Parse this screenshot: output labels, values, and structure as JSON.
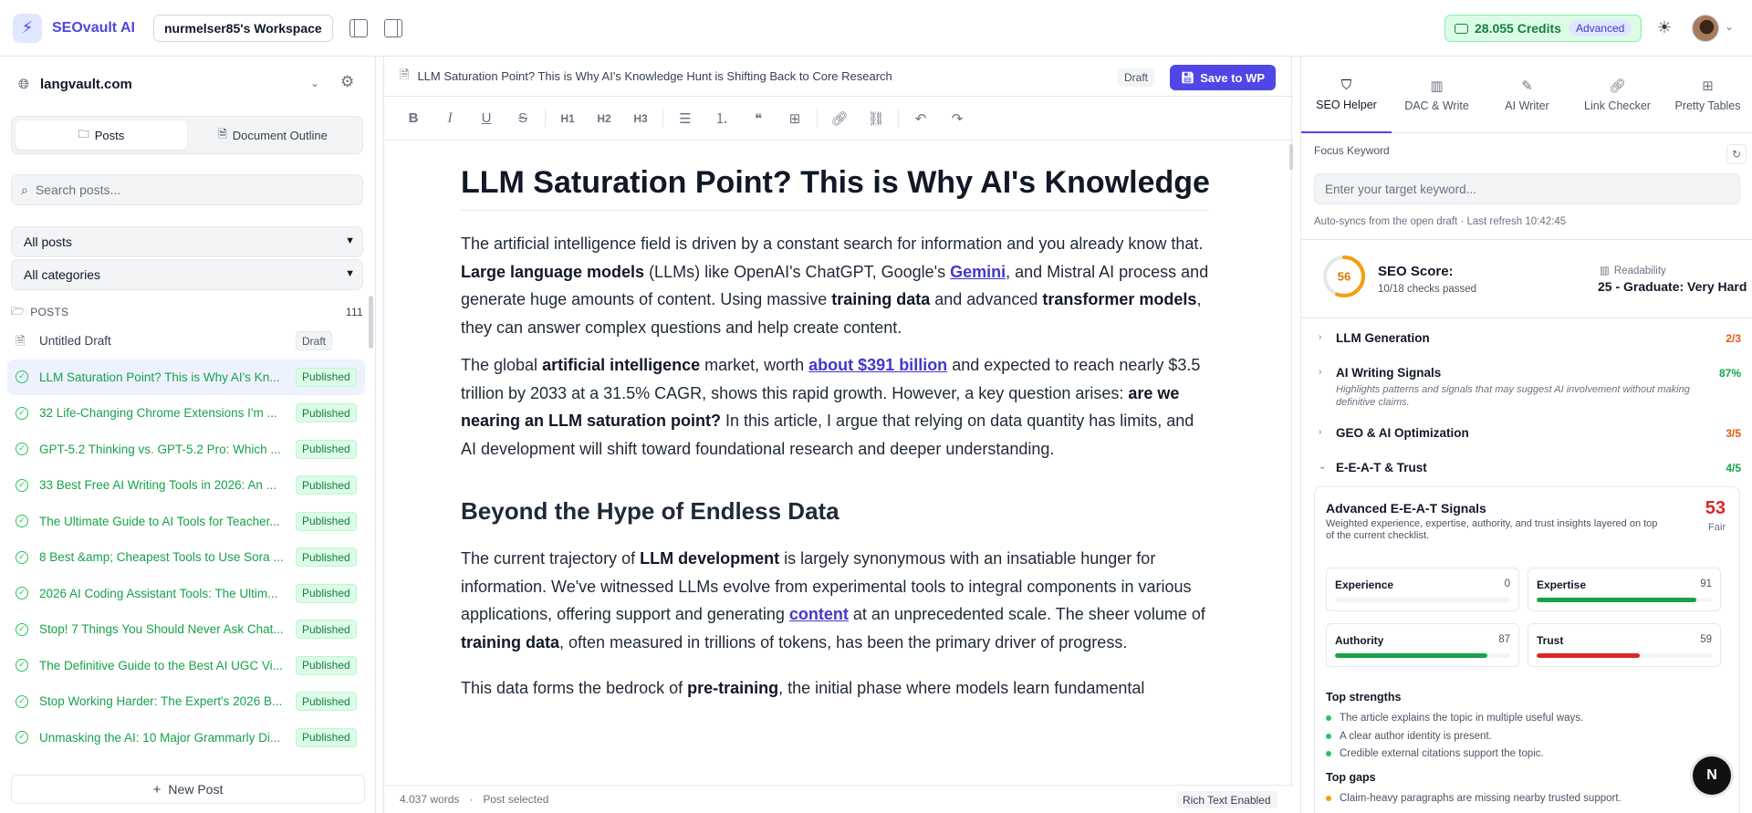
{
  "app": {
    "name": "SEOvault AI",
    "workspace": "nurmelser85's Workspace",
    "credits": "28.055 Credits",
    "plan": "Advanced",
    "accent": "#4f46e5"
  },
  "sidebar": {
    "site": "langvault.com",
    "tabs": [
      {
        "label": "Posts",
        "icon": "folder-icon",
        "active": true
      },
      {
        "label": "Document Outline",
        "icon": "document-icon",
        "active": false
      }
    ],
    "search_placeholder": "Search posts...",
    "filter_posts": "All posts",
    "filter_categories": "All categories",
    "posts_header": "POSTS",
    "posts_count": "111",
    "posts": [
      {
        "title": "Untitled Draft",
        "status": "Draft"
      },
      {
        "title": "LLM Saturation Point? This is Why AI's Kn...",
        "status": "Published"
      },
      {
        "title": "32 Life-Changing Chrome Extensions I'm ...",
        "status": "Published"
      },
      {
        "title": "GPT-5.2 Thinking vs. GPT-5.2 Pro: Which ...",
        "status": "Published"
      },
      {
        "title": "33 Best Free AI Writing Tools in 2026: An ...",
        "status": "Published"
      },
      {
        "title": "The Ultimate Guide to AI Tools for Teacher...",
        "status": "Published"
      },
      {
        "title": "8 Best &amp; Cheapest Tools to Use Sora ...",
        "status": "Published"
      },
      {
        "title": "2026 AI Coding Assistant Tools: The Ultim...",
        "status": "Published"
      },
      {
        "title": "Stop! 7 Things You Should Never Ask Chat...",
        "status": "Published"
      },
      {
        "title": "The Definitive Guide to the Best AI UGC Vi...",
        "status": "Published"
      },
      {
        "title": "Stop Working Harder: The Expert's 2026 B...",
        "status": "Published"
      },
      {
        "title": "Unmasking the AI: 10 Major Grammarly Di...",
        "status": "Published"
      }
    ],
    "new_post": "New Post"
  },
  "editor": {
    "doc_title": "LLM Saturation Point? This is Why AI's Knowledge Hunt is Shifting Back to Core Research",
    "status_chip": "Draft",
    "save_label": "Save to WP",
    "toolbar": {
      "h1": "H1",
      "h2": "H2",
      "h3": "H3"
    },
    "heading": "LLM Saturation Point? This is Why AI's Knowledge",
    "p1": {
      "a": "The artificial intelligence field is driven by a constant search for information and you already know that. ",
      "b": "Large language models",
      "c": " (LLMs) like OpenAI's ChatGPT, Google's ",
      "link": "Gemini",
      "d": ", and Mistral AI process and generate huge amounts of content. Using massive ",
      "e": "training data",
      "f": " and advanced ",
      "g": "transformer models",
      "h": ", they can answer complex questions and help create content."
    },
    "p2": {
      "a": "The global ",
      "b": "artificial intelligence",
      "c": " market, worth ",
      "link": "about $391 billion",
      "d": " and expected to reach nearly $3.5 trillion by 2033 at a 31.5% CAGR, shows this rapid growth. However, a key question arises: ",
      "e": "are we nearing an LLM saturation point?",
      "f": " In this article, I argue that relying on data quantity has limits, and AI development will shift toward foundational research and deeper understanding."
    },
    "h2": "Beyond the Hype of Endless Data",
    "p3": {
      "a": "The current trajectory of ",
      "b": "LLM development",
      "c": " is largely synonymous with an insatiable hunger for information. We've witnessed LLMs evolve from experimental tools to integral components in various applications, offering support and generating ",
      "link": "content",
      "d": " at an unprecedented scale. The sheer volume of ",
      "e": "training data",
      "f": ", often measured in trillions of tokens, has been the primary driver of progress."
    },
    "p4": {
      "a": "This data forms the bedrock of ",
      "b": "pre-training",
      "c": ", the initial phase where models learn fundamental"
    },
    "word_count": "4.037 words",
    "post_selected": "Post selected",
    "rich_text": "Rich Text Enabled"
  },
  "right_panel": {
    "tabs": [
      {
        "label": "SEO Helper",
        "icon": "shield-icon"
      },
      {
        "label": "DAC & Write",
        "icon": "bar-chart-icon"
      },
      {
        "label": "AI Writer",
        "icon": "magic-wand-icon"
      },
      {
        "label": "Link Checker",
        "icon": "link-icon"
      },
      {
        "label": "Pretty Tables",
        "icon": "table-icon"
      }
    ],
    "focus_keyword_label": "Focus Keyword",
    "focus_keyword_placeholder": "Enter your target keyword...",
    "autosync": "Auto-syncs from the open draft · Last refresh 10:42:45",
    "seo_score": 56,
    "seo_score_max": 100,
    "seo_score_label": "SEO Score:",
    "checks_passed": "10/18 checks passed",
    "readability_label": "Readability",
    "readability_value": "25 - Graduate: Very Hard",
    "sections": [
      {
        "name": "LLM Generation",
        "value": "2/3",
        "color": "#ea580c",
        "expanded": false
      },
      {
        "name": "AI Writing Signals",
        "value": "87%",
        "color": "#16a34a",
        "desc": "Highlights patterns and signals that may suggest AI involvement without making definitive claims.",
        "expanded": false
      },
      {
        "name": "GEO & AI Optimization",
        "value": "3/5",
        "color": "#ea580c",
        "expanded": false
      },
      {
        "name": "E-E-A-T & Trust",
        "value": "4/5",
        "color": "#16a34a",
        "expanded": true
      }
    ],
    "eeat": {
      "title": "Advanced E-E-A-T Signals",
      "desc": "Weighted experience, expertise, authority, and trust insights layered on top of the current checklist.",
      "score": "53",
      "grade": "Fair",
      "metrics": [
        {
          "name": "Experience",
          "value": 0,
          "color": "#22c55e"
        },
        {
          "name": "Expertise",
          "value": 91,
          "color": "#16a34a"
        },
        {
          "name": "Authority",
          "value": 87,
          "color": "#16a34a"
        },
        {
          "name": "Trust",
          "value": 59,
          "color": "#dc2626"
        }
      ],
      "strengths_title": "Top strengths",
      "strengths": [
        "The article explains the topic in multiple useful ways.",
        "A clear author identity is present.",
        "Credible external citations support the topic."
      ],
      "gaps_title": "Top gaps",
      "gaps": [
        "Claim-heavy paragraphs are missing nearby trusted support."
      ]
    }
  },
  "fab_label": "N"
}
